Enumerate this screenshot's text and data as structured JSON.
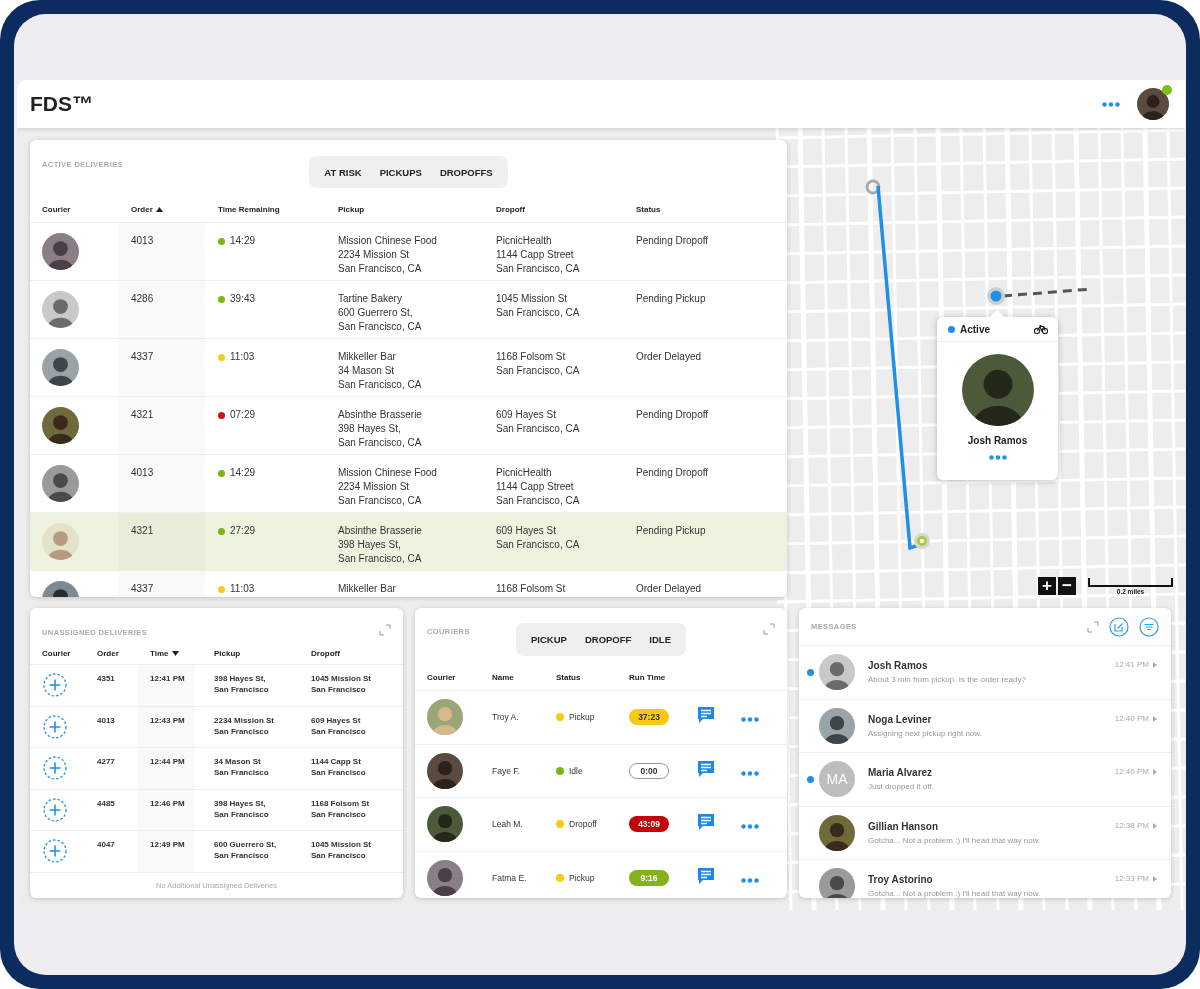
{
  "header": {
    "logo": "FDS™",
    "user_online": true
  },
  "active_deliveries": {
    "title": "ACTIVE DELIVERIES",
    "filters": [
      {
        "label": "AT RISK",
        "selected": false
      },
      {
        "label": "PICKUPS",
        "selected": false
      },
      {
        "label": "DROPOFFS",
        "selected": false
      }
    ],
    "columns": [
      {
        "label": "Courier"
      },
      {
        "label": "Order",
        "sorted_ascending": true
      },
      {
        "label": "Time Remaining"
      },
      {
        "label": "Pickup"
      },
      {
        "label": "Dropoff"
      },
      {
        "label": "Status"
      }
    ],
    "rows": [
      {
        "order": "4013",
        "time": "14:29",
        "color": "#80b319",
        "pickup": "Mission Chinese Food\n2234 Mission St\nSan Francisco, CA",
        "dropoff": "PicnicHealth\n1144 Capp Street\nSan Francisco, CA",
        "status": "Pending Dropoff",
        "selected": false
      },
      {
        "order": "4286",
        "time": "39:43",
        "color": "#80b319",
        "pickup": "Tartine Bakery\n600 Guerrero St,\nSan Francisco, CA",
        "dropoff": "1045 Mission St\nSan Francisco, CA",
        "status": "Pending Pickup",
        "selected": false
      },
      {
        "order": "4337",
        "time": "11:03",
        "color": "#f6cd16",
        "pickup": "Mikkeller Bar\n34 Mason St\nSan Francisco, CA",
        "dropoff": "1168 Folsom St\nSan Francisco, CA",
        "status": "Order Delayed",
        "selected": false
      },
      {
        "order": "4321",
        "time": "07:29",
        "color": "#c8141e",
        "pickup": "Absinthe Brasserie\n398 Hayes St,\nSan Francisco, CA",
        "dropoff": "609 Hayes St\nSan Francisco, CA",
        "status": "Pending Dropoff",
        "selected": false
      },
      {
        "order": "4013",
        "time": "14:29",
        "color": "#80b319",
        "pickup": "Mission Chinese Food\n2234 Mission St\nSan Francisco, CA",
        "dropoff": "PicnicHealth\n1144 Capp Street\nSan Francisco, CA",
        "status": "Pending Dropoff",
        "selected": false
      },
      {
        "order": "4321",
        "time": "27:29",
        "color": "#80b319",
        "pickup": "Absinthe Brasserie\n398 Hayes St,\nSan Francisco, CA",
        "dropoff": "609 Hayes St\nSan Francisco, CA",
        "status": "Pending Pickup",
        "selected": true
      },
      {
        "order": "4337",
        "time": "11:03",
        "color": "#f6cd16",
        "pickup": "Mikkeller Bar",
        "dropoff": "1168 Folsom St",
        "status": "Order Delayed",
        "selected": false
      }
    ]
  },
  "map": {
    "popup": {
      "status": "Active",
      "name": "Josh Ramos"
    },
    "zoom_in": "+",
    "zoom_out": "−",
    "scale": "0.2 miles"
  },
  "unassigned": {
    "title": "UNASSIGNED DELIVERIES",
    "columns": [
      {
        "label": "Courier"
      },
      {
        "label": "Order"
      },
      {
        "label": "Time",
        "sorted_descending": true
      },
      {
        "label": "Pickup"
      },
      {
        "label": "Dropoff"
      }
    ],
    "rows": [
      {
        "order": "4351",
        "time": "12:41 PM",
        "pickup": "398 Hayes St,\nSan Francisco",
        "dropoff": "1045 Mission St\nSan Francisco"
      },
      {
        "order": "4013",
        "time": "12:43 PM",
        "pickup": "2234 Mission St\nSan Francisco",
        "dropoff": "609 Hayes St\nSan Francisco"
      },
      {
        "order": "4277",
        "time": "12:44 PM",
        "pickup": "34 Mason St\nSan Francisco",
        "dropoff": "1144 Capp St\nSan Francisco"
      },
      {
        "order": "4485",
        "time": "12:46 PM",
        "pickup": "398 Hayes St,\nSan Francisco",
        "dropoff": "1168 Folsom St\nSan Francisco"
      },
      {
        "order": "4047",
        "time": "12:49 PM",
        "pickup": "600 Guerrero St,\nSan Francisco",
        "dropoff": "1045 Mission St\nSan Francisco"
      }
    ],
    "footer": "No Additional Unassigned Deliveries"
  },
  "couriers": {
    "title": "COURIERS",
    "filters": [
      {
        "label": "PICKUP",
        "selected": false
      },
      {
        "label": "DROPOFF",
        "selected": false
      },
      {
        "label": "IDLE",
        "selected": false
      }
    ],
    "columns": [
      {
        "label": "Courier"
      },
      {
        "label": "Name"
      },
      {
        "label": "Status"
      },
      {
        "label": "Run Time"
      }
    ],
    "rows": [
      {
        "name": "Troy A.",
        "status": "Pickup",
        "color": "#f6cd16",
        "run_time": "37:23",
        "kind": "yellow"
      },
      {
        "name": "Faye F.",
        "status": "Idle",
        "color": "#80b319",
        "run_time": "0:00",
        "kind": "outline"
      },
      {
        "name": "Leah M.",
        "status": "Dropoff",
        "color": "#f6cd16",
        "run_time": "43:09",
        "kind": "red"
      },
      {
        "name": "Fatma E.",
        "status": "Pickup",
        "color": "#f6cd16",
        "run_time": "9:16",
        "kind": "green"
      }
    ]
  },
  "messages": {
    "title": "MESSAGES",
    "items": [
      {
        "name": "Josh Ramos",
        "preview": "About 3 min from pickup. Is the order ready?",
        "time": "12:41 PM",
        "unread": true,
        "kind": "photo"
      },
      {
        "name": "Noga Leviner",
        "preview": "Assigning next pickup right now.",
        "time": "12:40 PM",
        "unread": false,
        "kind": "photo"
      },
      {
        "name": "Maria Alvarez",
        "preview": "Just dropped it off.",
        "time": "12:40 PM",
        "unread": true,
        "kind": "initials",
        "initials": "MA"
      },
      {
        "name": "Gillian Hanson",
        "preview": "Gotcha... Not a problem :) I'll head that way now.",
        "time": "12:38 PM",
        "unread": false,
        "kind": "photo"
      },
      {
        "name": "Troy Astorino",
        "preview": "Gotcha... Not a problem :) I'll head that way now.",
        "time": "12:33 PM",
        "unread": false,
        "kind": "photo"
      }
    ]
  }
}
